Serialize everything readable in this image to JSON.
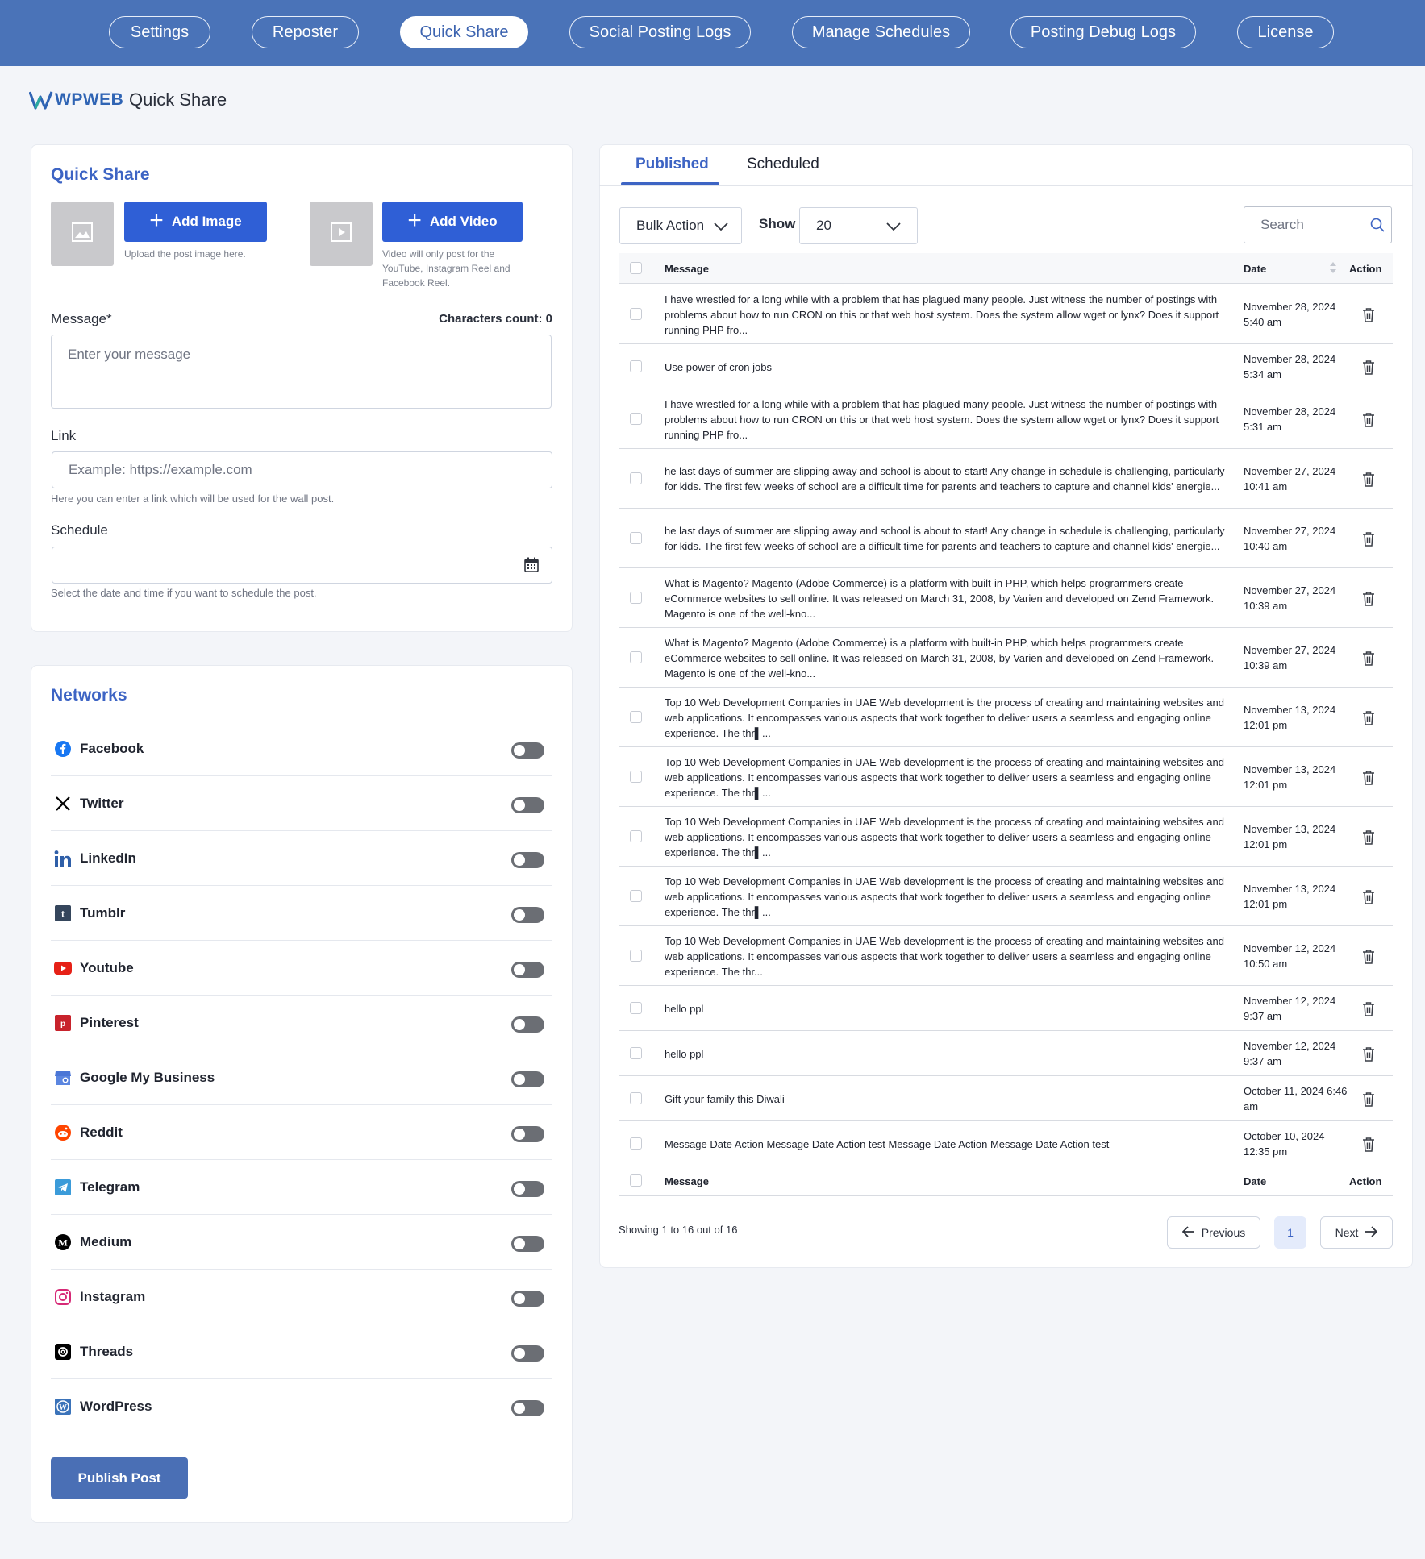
{
  "nav": [
    {
      "label": "Settings",
      "active": false
    },
    {
      "label": "Reposter",
      "active": false
    },
    {
      "label": "Quick Share",
      "active": true
    },
    {
      "label": "Social Posting Logs",
      "active": false
    },
    {
      "label": "Manage Schedules",
      "active": false
    },
    {
      "label": "Posting Debug Logs",
      "active": false
    },
    {
      "label": "License",
      "active": false
    }
  ],
  "brand": {
    "logo_text": "WPWEB",
    "page_title": "Quick Share"
  },
  "quick_share": {
    "title": "Quick Share",
    "add_image_label": "Add Image",
    "image_hint": "Upload the post image here.",
    "add_video_label": "Add Video",
    "video_hint": "Video will only post for the YouTube, Instagram Reel and Facebook Reel.",
    "message_label": "Message*",
    "characters_count": "Characters count: 0",
    "message_placeholder": "Enter your message",
    "link_label": "Link",
    "link_placeholder": "Example: https://example.com",
    "link_hint": "Here you can enter a link which will be used for the wall post.",
    "schedule_label": "Schedule",
    "schedule_hint": "Select the date and time if you want to schedule the post."
  },
  "networks": {
    "title": "Networks",
    "items": [
      {
        "name": "Facebook",
        "icon": "facebook-icon",
        "color": "#1877f2",
        "enabled": false
      },
      {
        "name": "Twitter",
        "icon": "x-icon",
        "color": "#000000",
        "enabled": false
      },
      {
        "name": "LinkedIn",
        "icon": "linkedin-icon",
        "color": "#2f5fa8",
        "enabled": false
      },
      {
        "name": "Tumblr",
        "icon": "tumblr-icon",
        "color": "#35465c",
        "enabled": false
      },
      {
        "name": "Youtube",
        "icon": "youtube-icon",
        "color": "#e62117",
        "enabled": false
      },
      {
        "name": "Pinterest",
        "icon": "pinterest-icon",
        "color": "#c8232c",
        "enabled": false
      },
      {
        "name": "Google My Business",
        "icon": "google-my-business-icon",
        "color": "#4a76d6",
        "enabled": false
      },
      {
        "name": "Reddit",
        "icon": "reddit-icon",
        "color": "#ff4500",
        "enabled": false
      },
      {
        "name": "Telegram",
        "icon": "telegram-icon",
        "color": "#3b9bd9",
        "enabled": false
      },
      {
        "name": "Medium",
        "icon": "medium-icon",
        "color": "#000000",
        "enabled": false
      },
      {
        "name": "Instagram",
        "icon": "instagram-icon",
        "color": "#d62976",
        "enabled": false
      },
      {
        "name": "Threads",
        "icon": "threads-icon",
        "color": "#000000",
        "enabled": false
      },
      {
        "name": "WordPress",
        "icon": "wordpress-icon",
        "color": "#3b73b9",
        "enabled": false
      }
    ],
    "publish_label": "Publish Post"
  },
  "tabs": [
    {
      "label": "Published",
      "active": true
    },
    {
      "label": "Scheduled",
      "active": false
    }
  ],
  "toolbar": {
    "bulk_action": "Bulk Action",
    "show_label": "Show",
    "show_value": "20",
    "search_placeholder": "Search"
  },
  "table": {
    "col_message": "Message",
    "col_date": "Date",
    "col_action": "Action",
    "rows": [
      {
        "message": "I have wrestled for a long while with a problem that has plagued many people. Just witness the number of postings with problems about how to run CRON on this or that web host system. Does the system allow wget or lynx? Does it support running PHP fro...",
        "date": "November 28, 2024 5:40 am"
      },
      {
        "message": "Use power of cron jobs",
        "date": "November 28, 2024 5:34 am"
      },
      {
        "message": "I have wrestled for a long while with a problem that has plagued many people. Just witness the number of postings with problems about how to run CRON on this or that web host system. Does the system allow wget or lynx? Does it support running PHP fro...",
        "date": "November 28, 2024 5:31 am"
      },
      {
        "message": "he last days of summer are slipping away and school is about to start! Any change in schedule is challenging, particularly for kids. The first few weeks of school are a difficult time for parents and teachers to capture and channel kids' energie...",
        "date": "November 27, 2024 10:41 am"
      },
      {
        "message": "he last days of summer are slipping away and school is about to start! Any change in schedule is challenging, particularly for kids. The first few weeks of school are a difficult time for parents and teachers to capture and channel kids' energie...",
        "date": "November 27, 2024 10:40 am"
      },
      {
        "message": "What is Magento? Magento (Adobe Commerce) is a platform with built-in PHP, which helps programmers create eCommerce websites to sell online. It was released on March 31, 2008, by Varien and developed on Zend Framework. Magento is one of the well-kno...",
        "date": "November 27, 2024 10:39 am"
      },
      {
        "message": "What is Magento? Magento (Adobe Commerce) is a platform with built-in PHP, which helps programmers create eCommerce websites to sell online. It was released on March 31, 2008, by Varien and developed on Zend Framework. Magento is one of the well-kno...",
        "date": "November 27, 2024 10:39 am"
      },
      {
        "message": "Top 10 Web Development Companies in UAE Web development is the process of creating and maintaining websites and web applications. It encompasses various aspects that work together to deliver users a seamless and engaging online experience. The thr▌...",
        "date": "November 13, 2024 12:01 pm"
      },
      {
        "message": "Top 10 Web Development Companies in UAE Web development is the process of creating and maintaining websites and web applications. It encompasses various aspects that work together to deliver users a seamless and engaging online experience. The thr▌...",
        "date": "November 13, 2024 12:01 pm"
      },
      {
        "message": "Top 10 Web Development Companies in UAE Web development is the process of creating and maintaining websites and web applications. It encompasses various aspects that work together to deliver users a seamless and engaging online experience. The thr▌...",
        "date": "November 13, 2024 12:01 pm"
      },
      {
        "message": "Top 10 Web Development Companies in UAE Web development is the process of creating and maintaining websites and web applications. It encompasses various aspects that work together to deliver users a seamless and engaging online experience. The thr▌...",
        "date": "November 13, 2024 12:01 pm"
      },
      {
        "message": "Top 10 Web Development Companies in UAE Web development is the process of creating and maintaining websites and web applications. It encompasses various aspects that work together to deliver users a seamless and engaging online experience. The thr...",
        "date": "November 12, 2024 10:50 am"
      },
      {
        "message": "hello ppl",
        "date": "November 12, 2024 9:37 am"
      },
      {
        "message": "hello ppl",
        "date": "November 12, 2024 9:37 am"
      },
      {
        "message": "Gift your family this Diwali",
        "date": "October 11, 2024 6:46 am"
      },
      {
        "message": "Message Date Action Message Date Action test Message Date Action Message Date Action test",
        "date": "October 10, 2024 12:35 pm"
      }
    ]
  },
  "pagination": {
    "showing": "Showing 1 to 16 out of 16",
    "previous": "Previous",
    "page": "1",
    "next": "Next"
  }
}
